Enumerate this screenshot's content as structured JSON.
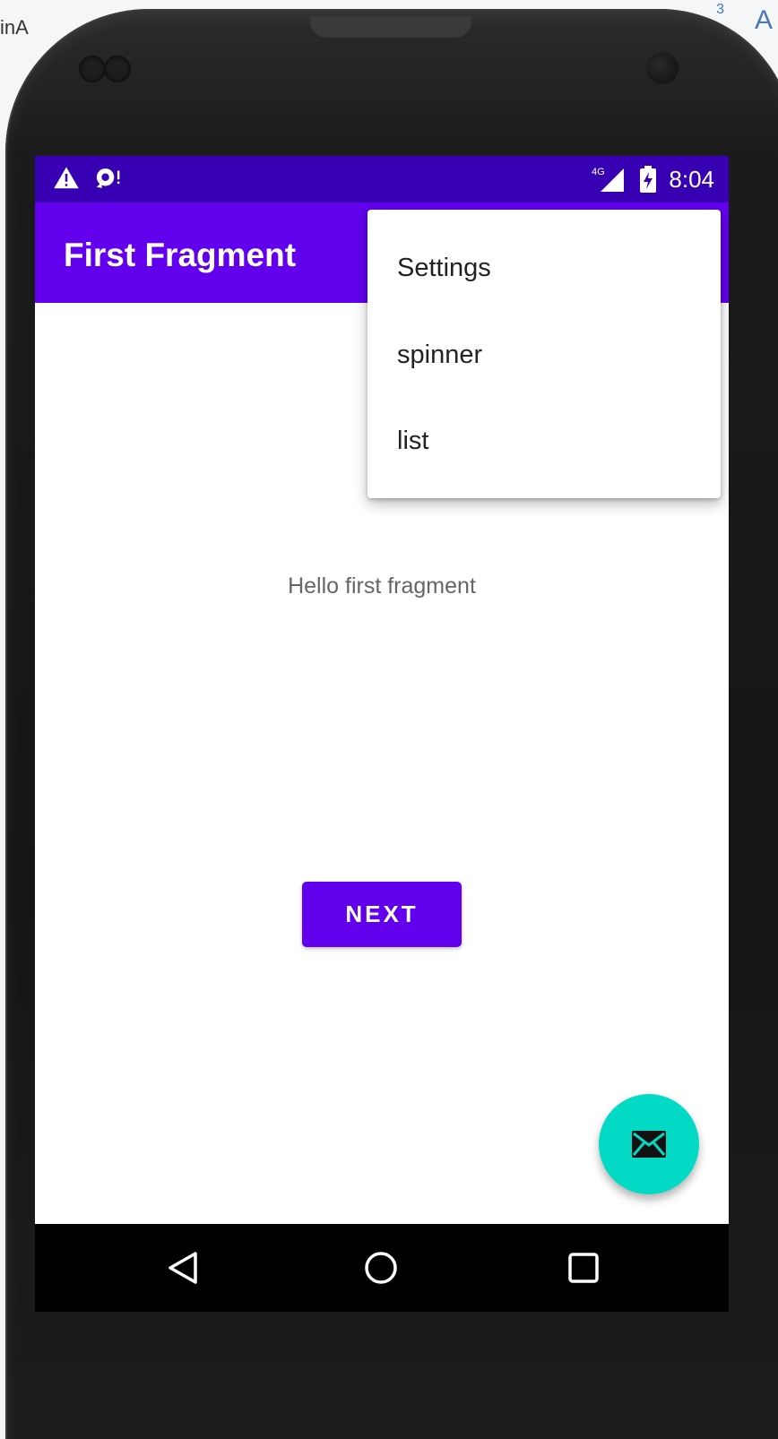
{
  "desktop": {
    "left_fragment": "inA",
    "right_fragment": "A",
    "right_sup": "3"
  },
  "status_bar": {
    "time": "8:04",
    "network": "4G",
    "icons": [
      "warning-icon",
      "sync-alert-icon",
      "signal-icon",
      "battery-charging-icon"
    ]
  },
  "app_bar": {
    "title": "First Fragment"
  },
  "overflow_menu": {
    "items": [
      {
        "label": "Settings"
      },
      {
        "label": "spinner"
      },
      {
        "label": "list"
      }
    ]
  },
  "content": {
    "text": "Hello first fragment",
    "next_button_label": "NEXT"
  },
  "fab": {
    "icon": "mail-icon"
  },
  "nav_bar": {
    "icons": [
      "back-icon",
      "home-icon",
      "recents-icon"
    ]
  },
  "colors": {
    "status_bar": "#3700b3",
    "primary": "#6200ee",
    "fab": "#03dac5"
  }
}
